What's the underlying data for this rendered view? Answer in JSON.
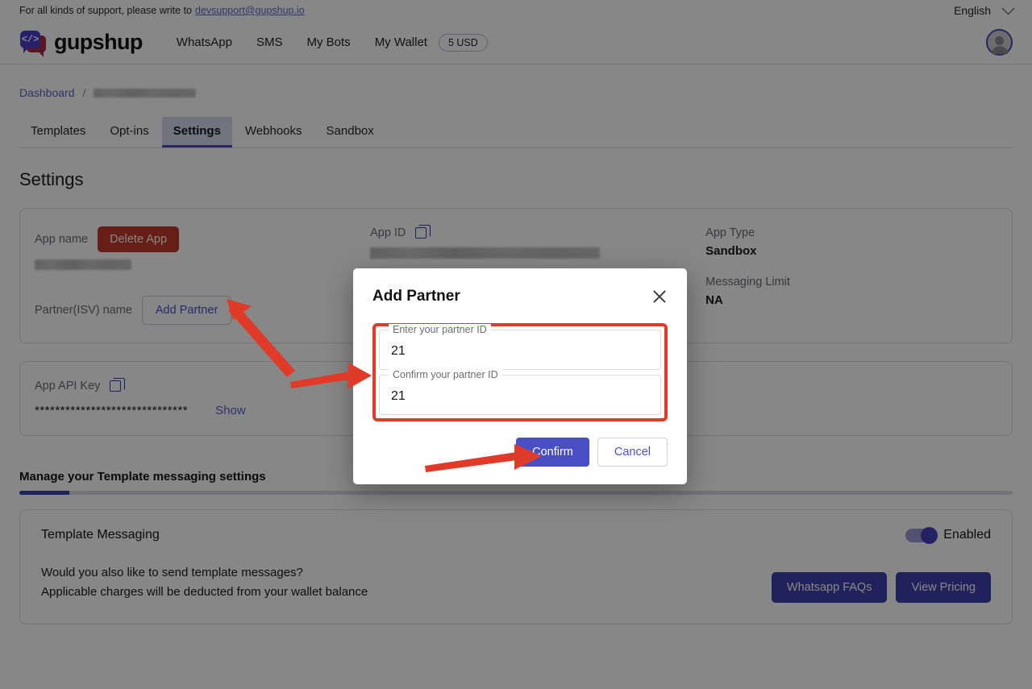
{
  "support": {
    "text": "For all kinds of support, please write to",
    "email": "devsupport@gupshup.io"
  },
  "language": {
    "selected": "English",
    "chevron_icon": "chevron-down-icon"
  },
  "brand": {
    "name": "gupshup",
    "logo_glyph": "</>"
  },
  "nav": {
    "links": [
      {
        "label": "WhatsApp"
      },
      {
        "label": "SMS"
      },
      {
        "label": "My Bots"
      },
      {
        "label": "My Wallet"
      }
    ],
    "wallet_balance": "5 USD",
    "avatar_icon": "user-avatar-icon"
  },
  "breadcrumb": {
    "root": "Dashboard",
    "separator": "/",
    "current": ""
  },
  "tabs": [
    {
      "label": "Templates",
      "active": false
    },
    {
      "label": "Opt-ins",
      "active": false
    },
    {
      "label": "Settings",
      "active": true
    },
    {
      "label": "Webhooks",
      "active": false
    },
    {
      "label": "Sandbox",
      "active": false
    }
  ],
  "page": {
    "title": "Settings"
  },
  "settings_card": {
    "app_name_label": "App name",
    "app_name_value": "",
    "delete_app_label": "Delete App",
    "partner_label": "Partner(ISV) name",
    "add_partner_label": "Add Partner",
    "app_id_label": "App ID",
    "app_id_value": "",
    "copy_icon": "copy-icon",
    "app_type_label": "App Type",
    "app_type_value": "Sandbox",
    "messaging_limit_label": "Messaging Limit",
    "messaging_limit_value": "NA"
  },
  "api_card": {
    "label": "App API Key",
    "copy_icon": "copy-icon",
    "masked_value": "******************************",
    "show_label": "Show"
  },
  "manage": {
    "heading": "Manage your Template messaging settings",
    "progress_percent": 5
  },
  "template_messaging": {
    "title": "Template Messaging",
    "toggle_state_label": "Enabled",
    "toggle_on": true,
    "line1": "Would you also like to send template messages?",
    "line2": "Applicable charges will be deducted from your wallet balance",
    "faq_button": "Whatsapp FAQs",
    "pricing_button": "View Pricing"
  },
  "modal": {
    "title": "Add Partner",
    "close_icon": "close-icon",
    "fields": [
      {
        "label": "Enter your partner ID",
        "value": "21"
      },
      {
        "label": "Confirm your partner ID",
        "value": "21"
      }
    ],
    "confirm_label": "Confirm",
    "cancel_label": "Cancel"
  },
  "annotations": {
    "arrow_color": "#e03a28",
    "highlight_color": "#e03a28"
  }
}
